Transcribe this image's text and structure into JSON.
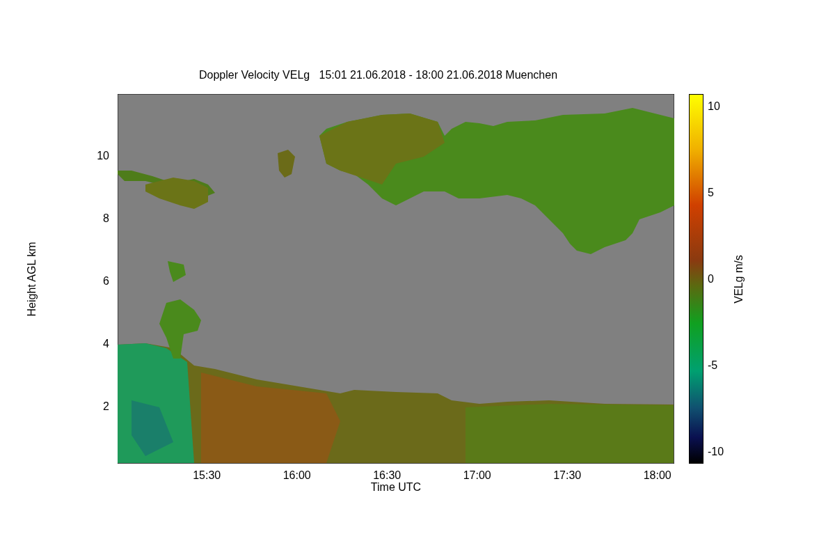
{
  "title": "Doppler Velocity VELg   15:01 21.06.2018 - 18:00 21.06.2018 Muenchen",
  "y_axis": {
    "label": "Height AGL km",
    "ticks": [
      "10",
      "8",
      "6",
      "4",
      "2"
    ]
  },
  "x_axis": {
    "label": "Time UTC",
    "ticks": [
      "15:30",
      "16:00",
      "16:30",
      "17:00",
      "17:30",
      "18:00"
    ]
  },
  "colorbar": {
    "label": "VELg m/s",
    "ticks": [
      "10",
      "5",
      "0",
      "-5",
      "-10"
    ]
  }
}
